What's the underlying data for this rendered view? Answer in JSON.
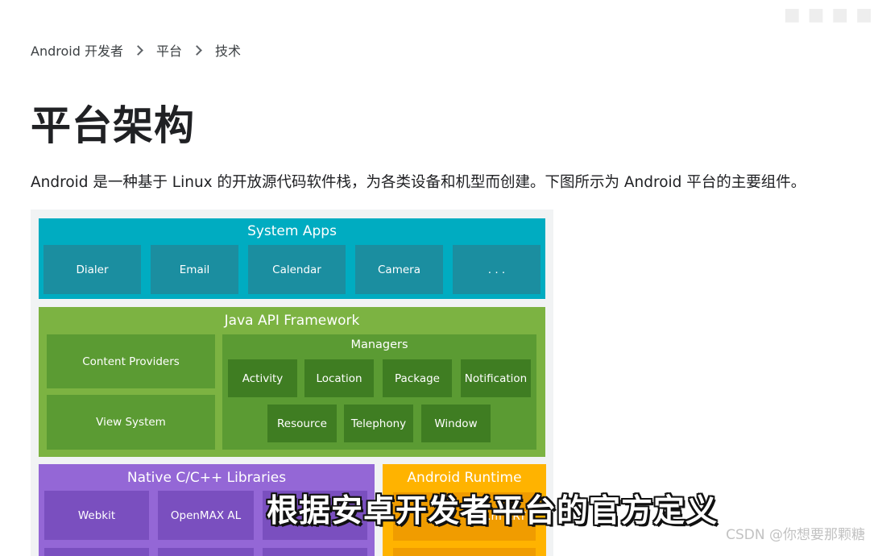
{
  "watermark_top": "■ ■  ■  ■",
  "breadcrumb": {
    "items": [
      "Android 开发者",
      "平台",
      "技术"
    ]
  },
  "page_title": "平台架构",
  "intro": "Android 是一种基于 Linux 的开放源代码软件栈，为各类设备和机型而创建。下图所示为 Android 平台的主要组件。",
  "diagram": {
    "system_apps": {
      "title": "System Apps",
      "items": [
        "Dialer",
        "Email",
        "Calendar",
        "Camera",
        ". . ."
      ]
    },
    "java_api": {
      "title": "Java API Framework",
      "left_items": [
        "Content Providers",
        "View System"
      ],
      "managers_title": "Managers",
      "managers_row1": [
        "Activity",
        "Location",
        "Package",
        "Notification"
      ],
      "managers_row2": [
        "Resource",
        "Telephony",
        "Window"
      ]
    },
    "native_libs": {
      "title": "Native C/C++ Libraries",
      "items": [
        "Webkit",
        "OpenMAX AL",
        ""
      ]
    },
    "android_runtime": {
      "title": "Android Runtime",
      "item": "…m ART"
    },
    "colors": {
      "system_apps": "#00acc1",
      "java_api": "#7cb342",
      "native_libs": "#9467d6",
      "android_runtime": "#ffb300"
    }
  },
  "caption": "根据安卓开发者平台的官方定义",
  "csdn_watermark": "CSDN @你想要那颗糖"
}
